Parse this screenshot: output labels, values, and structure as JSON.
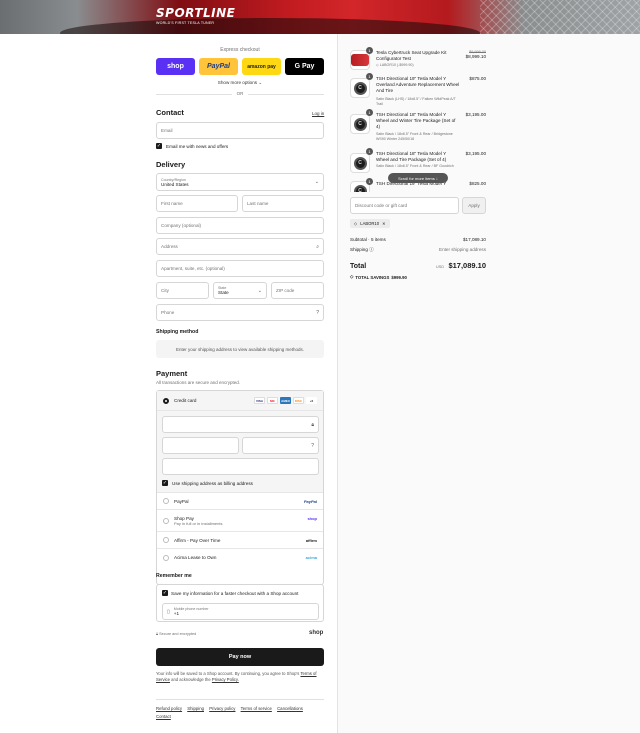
{
  "brand": {
    "name": "SPORTLINE",
    "tagline": "WORLD'S FIRST TESLA TUNER"
  },
  "express": {
    "title": "Express checkout",
    "buttons": {
      "shop": "shop",
      "paypal": "PayPal",
      "amazon": "amazon pay",
      "gpay": "G Pay"
    },
    "more_options": "Show more options ⌄",
    "or": "OR"
  },
  "contact": {
    "heading": "Contact",
    "login": "Log in",
    "email_placeholder": "Email",
    "news_label": "Email me with news and offers"
  },
  "delivery": {
    "heading": "Delivery",
    "country_label": "Country/Region",
    "country_value": "United States",
    "first_name": "First name",
    "last_name": "Last name",
    "company": "Company (optional)",
    "address": "Address",
    "apartment": "Apartment, suite, etc. (optional)",
    "city": "City",
    "state_label": "State",
    "state_value": "State",
    "zip": "ZIP code",
    "phone": "Phone"
  },
  "shipping_method": {
    "heading": "Shipping method",
    "message": "Enter your shipping address to view available shipping methods."
  },
  "payment": {
    "heading": "Payment",
    "subtitle": "All transactions are secure and encrypted.",
    "credit_card": "Credit card",
    "card_icons": [
      "VISA",
      "MC",
      "AMEX",
      "DISC",
      "+6"
    ],
    "billing_same": "Use shipping address as billing address",
    "paypal": "PayPal",
    "paypal_tag": "PayPal",
    "shop_pay": "Shop Pay",
    "shop_pay_sub": "Pay in full or in installments",
    "shop_pay_tag": "shop",
    "affirm": "Affirm - Pay Over Time",
    "affirm_tag": "affirm",
    "acima": "Acima Lease to Own",
    "acima_tag": "acima"
  },
  "remember": {
    "heading": "Remember me",
    "save_label": "Save my information for a faster checkout with a Shop account",
    "phone_label": "Mobile phone number",
    "phone_value": "+1",
    "secure": "Secure and encrypted",
    "shop_logo": "shop"
  },
  "pay_now": "Pay now",
  "legal": {
    "text": "Your info will be saved to a Shop account. By continuing, you agree to Shop's",
    "tos": "Terms of Service",
    "and": "and acknowledge the",
    "privacy": "Privacy Policy."
  },
  "footer_links": [
    "Refund policy",
    "Shipping",
    "Privacy policy",
    "Terms of service",
    "Cancellations",
    "Contact"
  ],
  "cart": {
    "items": [
      {
        "qty": "1",
        "title": "Tesla Cybertruck Seat Upgrade Kit Configurator Test",
        "meta": "LABOR10 (-$999.90)",
        "old_price": "$9,999.00",
        "price": "$8,999.10"
      },
      {
        "qty": "1",
        "title": "TSH Directional 19\" Tesla Model Y Overland Adventure Replacement Wheel And Tire",
        "meta": "Satin Black (LHS) / 18x8.5\" / Falken WildPeak A/T Trail",
        "price": "$875.00"
      },
      {
        "qty": "1",
        "title": "TSH Directional 18\" Tesla Model Y Wheel and Winter Tire Package (Set of 4)",
        "meta": "Satin Black / 18x8.5\" Front & Rear / Bridgestone WS90 Winter 245/50/18",
        "price": "$3,195.00"
      },
      {
        "qty": "1",
        "title": "TSH Directional 18\" Tesla Model Y Wheel and Tire Package (Set of 4)",
        "meta": "Satin Black / 18x8.5\" Front & Rear / BF Goodrich",
        "price": "$3,195.00"
      },
      {
        "qty": "1",
        "title": "TSH Directional 19\" Tesla Model Y",
        "meta": "",
        "price": "$825.00"
      }
    ],
    "scroll_hint": "Scroll for more items ↓",
    "discount_placeholder": "Discount code or gift card",
    "apply": "Apply",
    "code": "LABOR10",
    "subtotal_label": "Subtotal · 5 items",
    "subtotal_value": "$17,089.10",
    "shipping_label": "Shipping",
    "shipping_value": "Enter shipping address",
    "total_label": "Total",
    "currency": "USD",
    "total_value": "$17,089.10",
    "savings_label": "TOTAL SAVINGS",
    "savings_value": "$999.90"
  }
}
